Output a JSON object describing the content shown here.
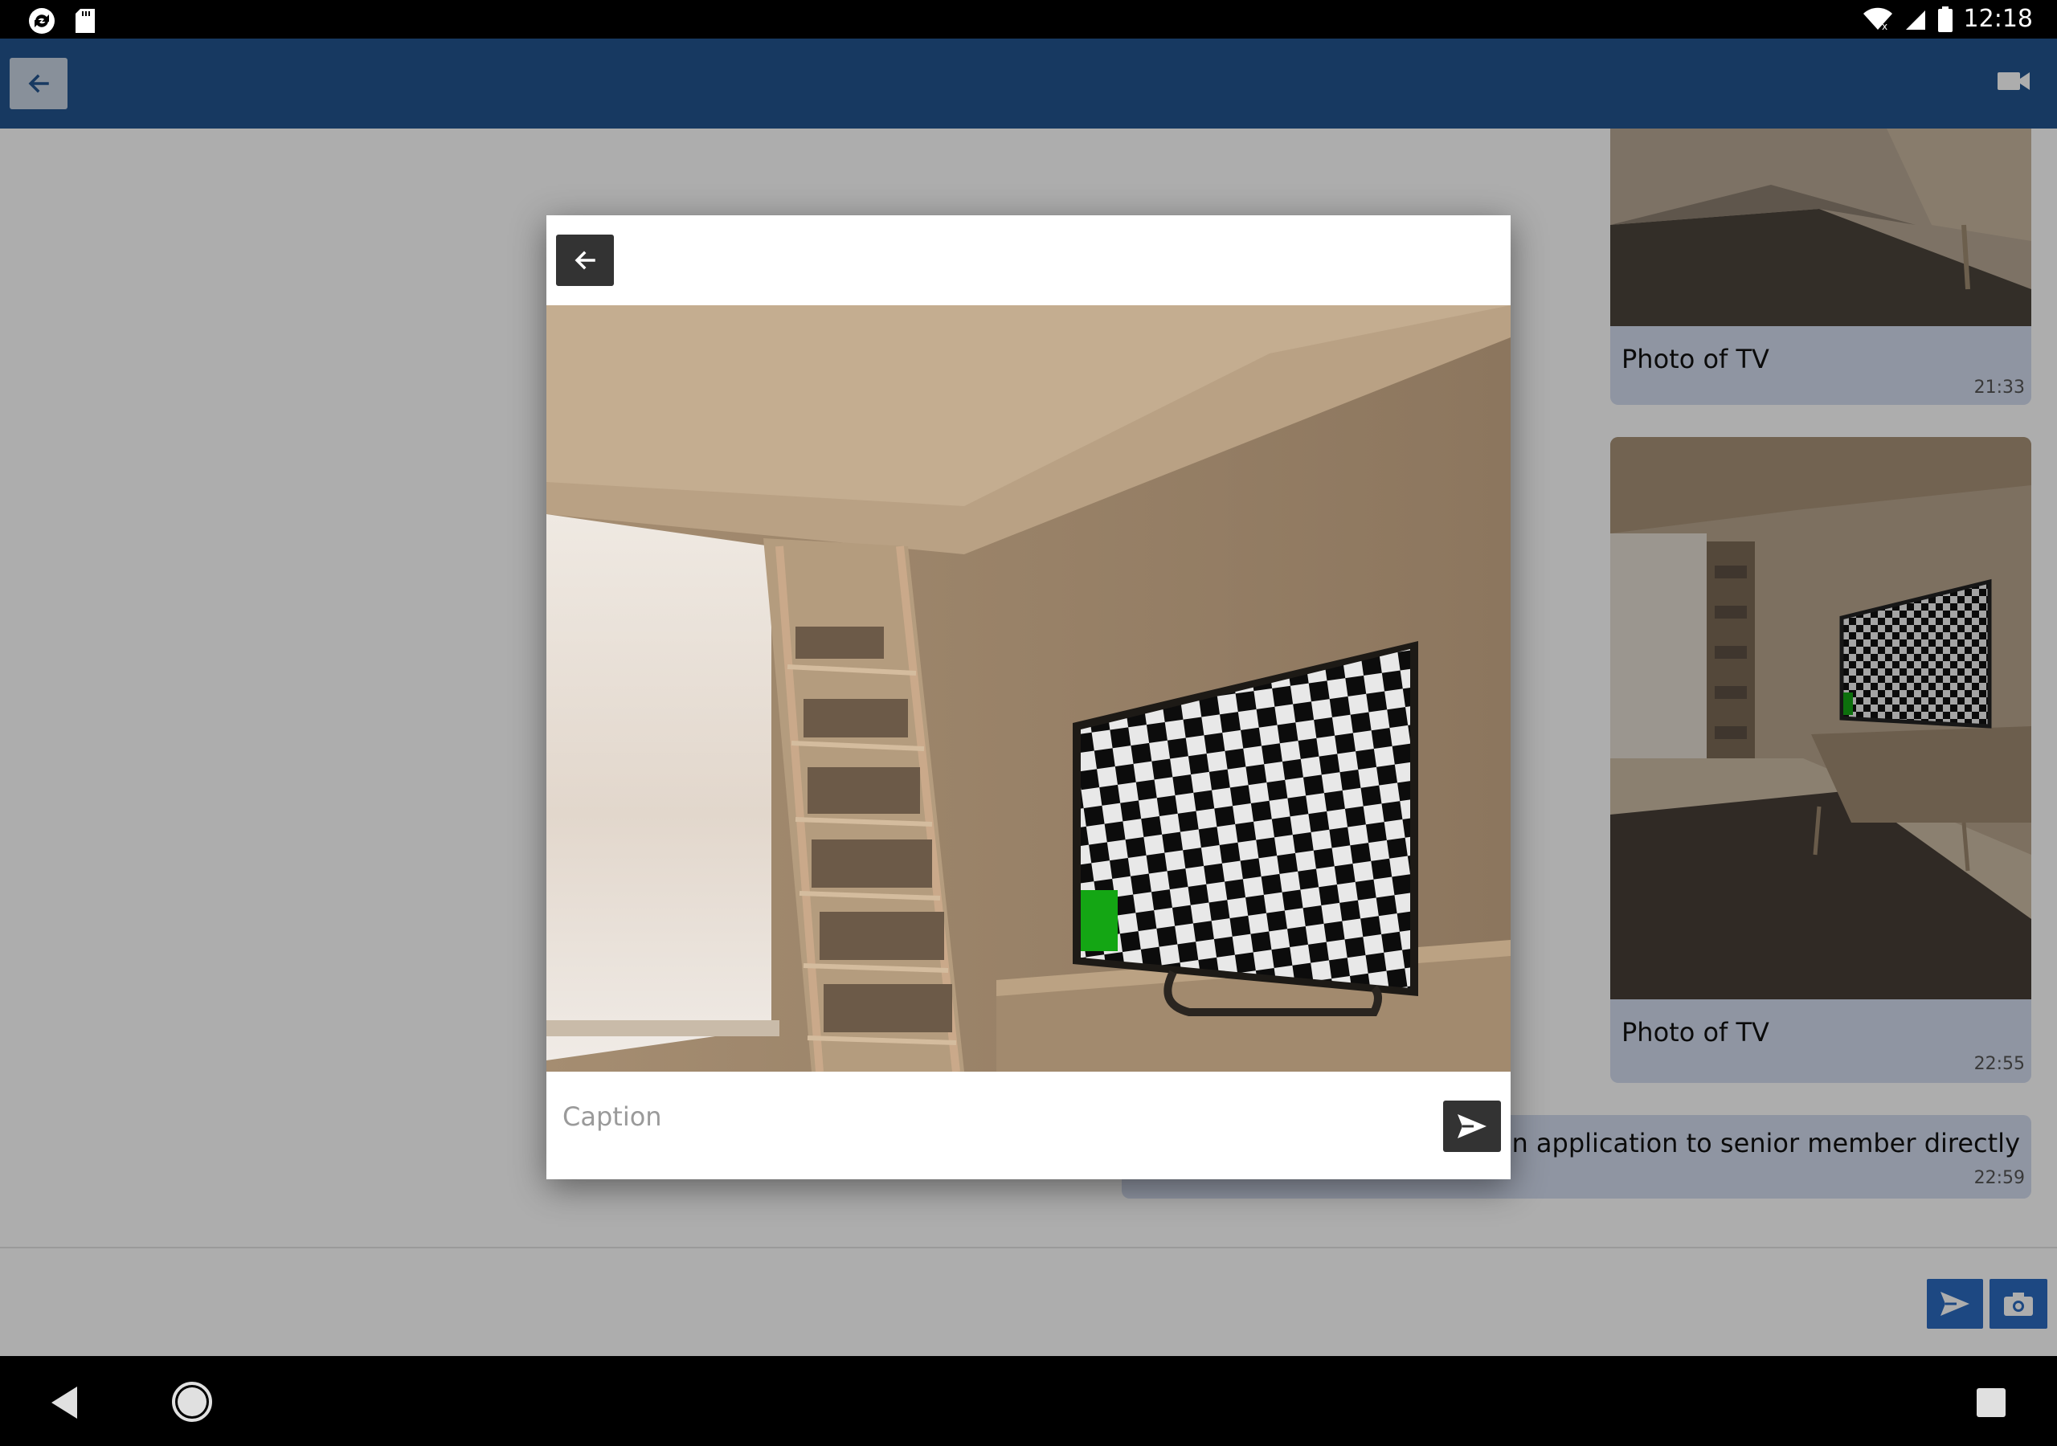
{
  "status_bar": {
    "time": "12:18"
  },
  "app_bar": {
    "back_icon": "arrow-left-icon",
    "video_icon": "video-camera-icon"
  },
  "messages": [
    {
      "caption": "Photo of TV",
      "time": "21:33"
    },
    {
      "caption": "Photo of TV",
      "time": "22:55"
    },
    {
      "text": "panion application to senior member directly",
      "time": "22:59"
    }
  ],
  "dialog": {
    "back_icon": "arrow-left-icon",
    "caption_placeholder": "Caption",
    "send_icon": "send-icon"
  },
  "colors": {
    "app_bar": "#23548f",
    "bubble": "#d3dcef",
    "accent_button": "#2b6ac0",
    "dialog_button": "#333333",
    "tv_highlight": "#14a614"
  }
}
